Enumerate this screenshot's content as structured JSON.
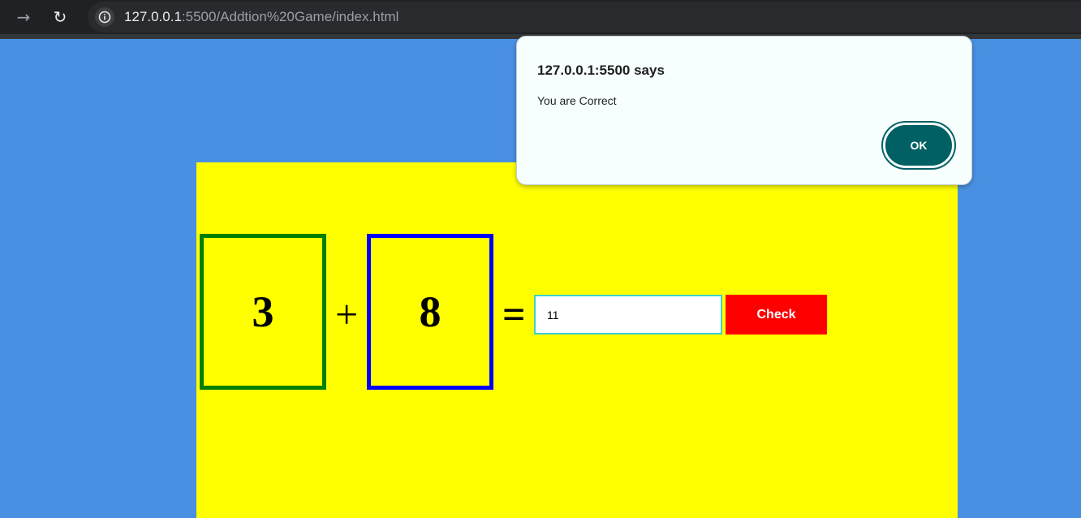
{
  "browser": {
    "forward_icon": "arrow-right",
    "reload_icon": "reload",
    "info_icon": "info-circle",
    "url_host": "127.0.0.1",
    "url_path": ":5500/Addtion%20Game/index.html"
  },
  "game": {
    "first_number": "3",
    "operator": "+",
    "second_number": "8",
    "equals": "=",
    "answer_value": "11",
    "check_label": "Check",
    "colors": {
      "page_background": "#4a90e2",
      "panel_background": "#ffff00",
      "first_box_border": "#008000",
      "second_box_border": "#0000ff",
      "check_button": "#ff0000"
    }
  },
  "alert": {
    "title": "127.0.0.1:5500 says",
    "message": "You are Correct",
    "ok_label": "OK",
    "button_color": "#006064"
  }
}
